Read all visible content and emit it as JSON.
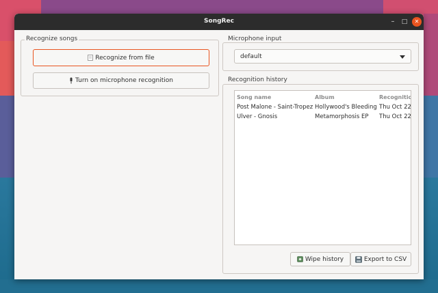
{
  "window": {
    "title": "SongRec",
    "minimize_glyph": "–",
    "maximize_glyph": "□",
    "close_glyph": "✕"
  },
  "recognize": {
    "frame_label": "Recognize songs",
    "file_button": "Recognize from file",
    "mic_button": "Turn on microphone recognition"
  },
  "microphone": {
    "frame_label": "Microphone input",
    "selected": "default"
  },
  "history": {
    "frame_label": "Recognition history",
    "columns": [
      "Song name",
      "Album",
      "Recognitio"
    ],
    "rows": [
      [
        "Post Malone - Saint-Tropez",
        "Hollywood's Bleeding",
        "Thu Oct 22"
      ],
      [
        "Ulver - Gnosis",
        "Metamorphosis EP",
        "Thu Oct 22"
      ]
    ],
    "wipe_button": "Wipe history",
    "export_button": "Export to CSV"
  },
  "colors": {
    "accent": "#e9541f",
    "titlebar": "#2c2c2c",
    "window_bg": "#f6f5f4"
  },
  "icons": {
    "file_button": "document-icon",
    "mic_button": "microphone-icon",
    "wipe_button": "wipe-icon",
    "export_button": "save-icon",
    "combo": "dropdown-arrow-icon"
  }
}
